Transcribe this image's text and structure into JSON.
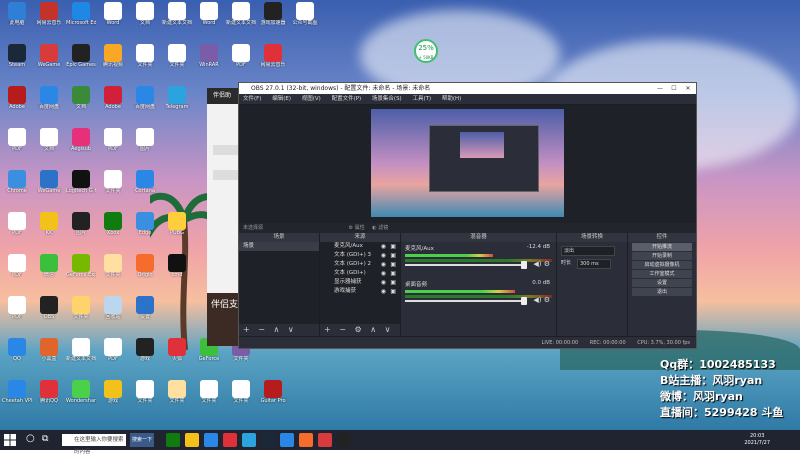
{
  "desktop": {
    "icons": [
      {
        "label": "此电脑",
        "color": "#2f7fd6"
      },
      {
        "label": "网易云音乐",
        "color": "#c3322b"
      },
      {
        "label": "Microsoft Edge",
        "color": "#1e88e5"
      },
      {
        "label": "Word",
        "color": "#ffffff"
      },
      {
        "label": "文档",
        "color": "#ffffff"
      },
      {
        "label": "新建文本文档",
        "color": "#ffffff"
      },
      {
        "label": "Word",
        "color": "#ffffff"
      },
      {
        "label": "新建文本文档",
        "color": "#ffffff"
      },
      {
        "label": "游戏加速器",
        "color": "#222222"
      },
      {
        "label": "公众号截图",
        "color": "#ffffff"
      },
      {
        "label": "Steam",
        "color": "#1b2838"
      },
      {
        "label": "WeGame",
        "color": "#d83b3b"
      },
      {
        "label": "Epic Games",
        "color": "#222222"
      },
      {
        "label": "腾讯视频",
        "color": "#f9a825"
      },
      {
        "label": "文件夹",
        "color": "#ffffff"
      },
      {
        "label": "文件夹",
        "color": "#ffffff"
      },
      {
        "label": "WinRAR",
        "color": "#7a5ca8"
      },
      {
        "label": "PDF",
        "color": "#ffffff"
      },
      {
        "label": "网易云音乐",
        "color": "#e0303a"
      },
      {
        "label": "Adobe",
        "color": "#b71c1c"
      },
      {
        "label": "百度网盘",
        "color": "#2b87e6"
      },
      {
        "label": "文档",
        "color": "#3a8a3a"
      },
      {
        "label": "Adobe",
        "color": "#d0203a"
      },
      {
        "label": "百度网盘",
        "color": "#2b87e6"
      },
      {
        "label": "Telegram",
        "color": "#2aa3df"
      },
      {
        "label": "PDF",
        "color": "#ffffff"
      },
      {
        "label": "文档",
        "color": "#ffffff"
      },
      {
        "label": "Aegisub",
        "color": "#e6307a"
      },
      {
        "label": "PDF",
        "color": "#ffffff"
      },
      {
        "label": "图片",
        "color": "#ffffff"
      },
      {
        "label": "Chrome",
        "color": "#3b8fe0"
      },
      {
        "label": "WeGame",
        "color": "#2b72c8"
      },
      {
        "label": "Logitech G HUB",
        "color": "#111111"
      },
      {
        "label": "文件夹",
        "color": "#ffffff"
      },
      {
        "label": "Cortana",
        "color": "#2b87e6"
      },
      {
        "label": "PDF",
        "color": "#ffffff"
      },
      {
        "label": "KK",
        "color": "#f2c21b"
      },
      {
        "label": "图片",
        "color": "#222222"
      },
      {
        "label": "Xbox",
        "color": "#107c10"
      },
      {
        "label": "Edge",
        "color": "#3b8fe0"
      },
      {
        "label": "PUBG",
        "color": "#ffce3a"
      },
      {
        "label": "PDF",
        "color": "#ffffff"
      },
      {
        "label": "微信",
        "color": "#3cbf3c"
      },
      {
        "label": "GeForce Experience",
        "color": "#76b900"
      },
      {
        "label": "文件夹",
        "color": "#ffe0a0"
      },
      {
        "label": "Origin",
        "color": "#f56c2d"
      },
      {
        "label": "cmd",
        "color": "#111111"
      },
      {
        "label": "PDF",
        "color": "#ffffff"
      },
      {
        "label": "OBS",
        "color": "#222222"
      },
      {
        "label": "文件夹",
        "color": "#ffd36b"
      },
      {
        "label": "回收站",
        "color": "#bcd6ee"
      },
      {
        "label": "设置",
        "color": "#2b72c8"
      },
      {
        "label": "QQ",
        "color": "#2b87e6"
      },
      {
        "label": "小黑盒",
        "color": "#e0652d"
      },
      {
        "label": "新建文本文档",
        "color": "#ffffff"
      },
      {
        "label": "PDF",
        "color": "#ffffff"
      },
      {
        "label": "游戏",
        "color": "#222222"
      },
      {
        "label": "火狐",
        "color": "#e0303a"
      },
      {
        "label": "GeForce",
        "color": "#3cbf3c"
      },
      {
        "label": "文件夹",
        "color": "#7a5ca8"
      },
      {
        "label": "Cheetah VPN",
        "color": "#2b87e6"
      },
      {
        "label": "腾讯QQ",
        "color": "#e0303a"
      },
      {
        "label": "Wondershare",
        "color": "#4ad04a"
      },
      {
        "label": "游戏",
        "color": "#f2c21b"
      },
      {
        "label": "文件夹",
        "color": "#ffffff"
      },
      {
        "label": "文件夹",
        "color": "#ffe0a0"
      },
      {
        "label": "文件夹",
        "color": "#ffffff"
      },
      {
        "label": "文件夹",
        "color": "#ffffff"
      },
      {
        "label": "Guitar Pro",
        "color": "#b71c1c"
      }
    ],
    "battery_badge": {
      "percent": "25%",
      "sub": "+ 50KB"
    }
  },
  "side_app": {
    "title": "伴侣助",
    "promo": "伴侣支"
  },
  "obs": {
    "title": "OBS 27.0.1 (32-bit, windows) - 配置文件: 未命名 - 场景: 未命名",
    "window_buttons": {
      "minimize": "—",
      "maximize": "☐",
      "close": "✕"
    },
    "menu": [
      "文件(F)",
      "编辑(E)",
      "视图(V)",
      "配置文件(P)",
      "场景集合(S)",
      "工具(T)",
      "帮助(H)"
    ],
    "mid_bar": {
      "no_source": "未选择源",
      "properties": "属性",
      "filters": "滤镜"
    },
    "docks": {
      "scenes": {
        "header": "场景",
        "items": [
          "场景"
        ]
      },
      "sources": {
        "header": "来源",
        "items": [
          {
            "label": "麦克风/Aux"
          },
          {
            "label": "文本 (GDI+) 3"
          },
          {
            "label": "文本 (GDI+) 2"
          },
          {
            "label": "文本 (GDI+)"
          },
          {
            "label": "显示器捕获"
          },
          {
            "label": "游戏捕获"
          }
        ]
      },
      "mixer": {
        "header": "混音器",
        "channels": [
          {
            "name": "麦克风/Aux",
            "db": "-12.4 dB"
          },
          {
            "name": "桌面音频",
            "db": "0.0 dB"
          }
        ]
      },
      "transitions": {
        "header": "场景转换",
        "type": "淡出",
        "duration_label": "时长",
        "duration_value": "300 ms"
      },
      "controls": {
        "header": "控件",
        "buttons": [
          "开始推流",
          "开始录制",
          "启动虚拟摄像机",
          "工作室模式",
          "设置",
          "退出"
        ]
      }
    },
    "dock_footer": {
      "add": "+",
      "remove": "−",
      "up": "∧",
      "down": "∨",
      "gear": "⚙"
    },
    "status": {
      "live": "LIVE: 00:00:00",
      "rec": "REC: 00:00:00",
      "cpu": "CPU: 3.7%, 30.00 fps"
    }
  },
  "overlay_text": [
    "Qq群：1002485133",
    "B站主播：风羽ryan",
    "微博：风羽ryan",
    "直播间：5299428 斗鱼"
  ],
  "taskbar": {
    "search_placeholder": "在这里输入你要搜索的内容",
    "active_app": "搜索一下",
    "clock_time": "20:03",
    "clock_date": "2021/7/27",
    "apps": [
      {
        "name": "xbox-icon",
        "color": "#107c10"
      },
      {
        "name": "file-explorer-icon",
        "color": "#f2c21b"
      },
      {
        "name": "store-icon",
        "color": "#2b87e6"
      },
      {
        "name": "netease-icon",
        "color": "#e0303a"
      },
      {
        "name": "telegram-icon",
        "color": "#2aa3df"
      },
      {
        "name": "steam-icon",
        "color": "#1b2838"
      },
      {
        "name": "vscode-icon",
        "color": "#2b87e6"
      },
      {
        "name": "firefox-icon",
        "color": "#f56c2d"
      },
      {
        "name": "wegame-icon",
        "color": "#d83b3b"
      },
      {
        "name": "obs-icon",
        "color": "#222222"
      }
    ]
  }
}
